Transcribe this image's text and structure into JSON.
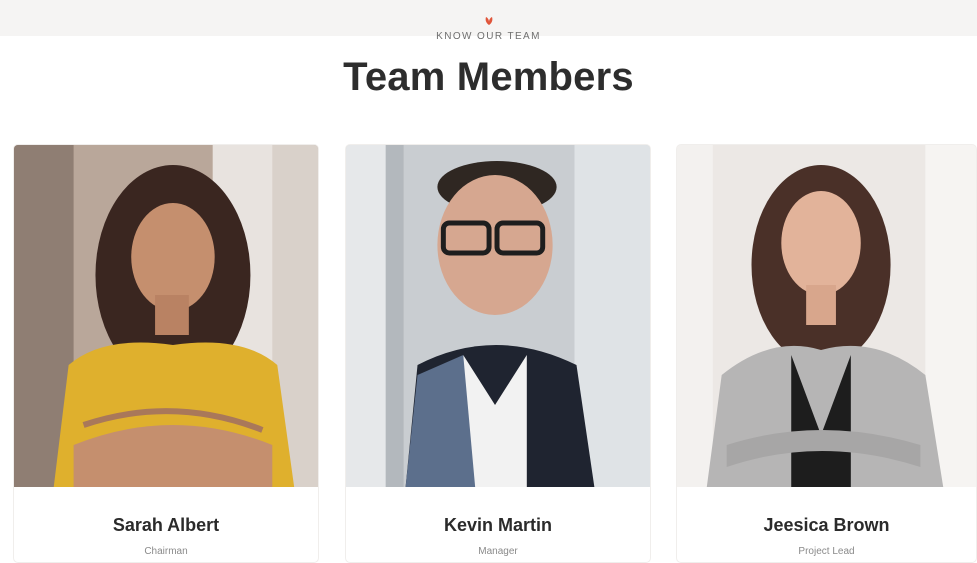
{
  "section": {
    "eyebrow": "KNOW OUR TEAM",
    "title": "Team Members",
    "icon": "leaf-icon",
    "accent_color": "#e0553a"
  },
  "members": [
    {
      "name": "Sarah Albert",
      "role": "Chairman",
      "photo": "portrait-woman-yellow-top"
    },
    {
      "name": "Kevin Martin",
      "role": "Manager",
      "photo": "portrait-man-glasses-suit"
    },
    {
      "name": "Jeesica Brown",
      "role": "Project Lead",
      "photo": "portrait-woman-grey-cardigan"
    }
  ]
}
